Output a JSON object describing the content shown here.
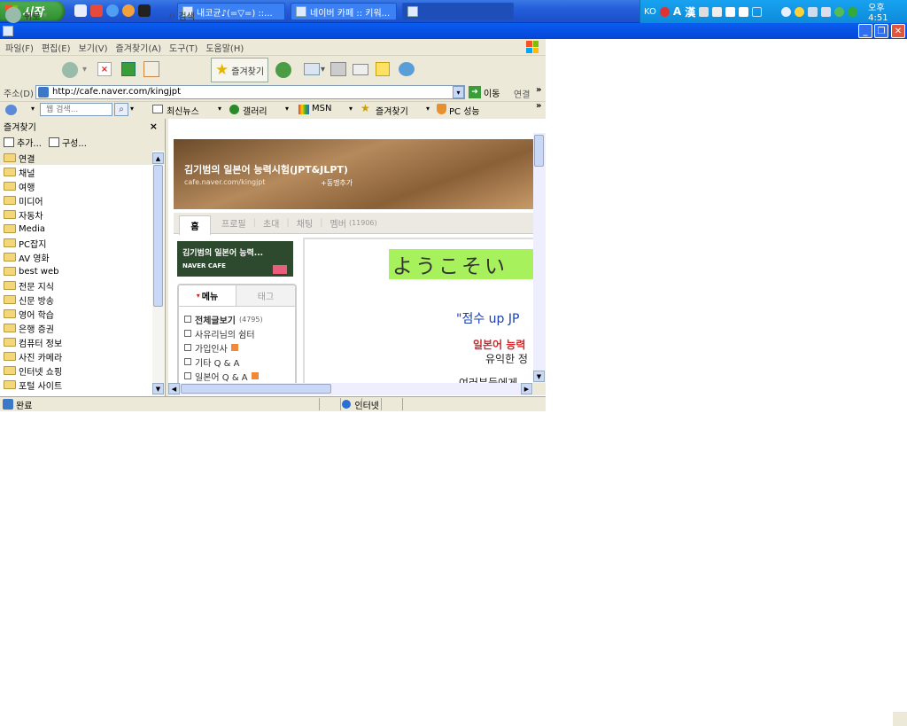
{
  "taskbar": {
    "start_label": "시작",
    "tasks": [
      {
        "label": "내코균♪(=▽=) ::..."
      },
      {
        "label": "네이버 카페 :: 키워..."
      },
      {
        "label": ""
      }
    ],
    "tray": {
      "ime": "KO",
      "ime_a": "A",
      "ime_han": "漢",
      "clock": "오후 4:51"
    }
  },
  "menu": {
    "items": [
      "파일(F)",
      "편집(E)",
      "보기(V)",
      "즐겨찾기(A)",
      "도구(T)",
      "도움말(H)"
    ]
  },
  "toolbar": {
    "back": "뒤로",
    "search": "검색",
    "favorites": "즐겨찾기"
  },
  "address": {
    "label": "주소(D)",
    "url": "http://cafe.naver.com/kingjpt",
    "go": "이동",
    "links": "연결"
  },
  "linksbar": {
    "search_placeholder": "웹 검색...",
    "news": "최신뉴스",
    "gallery": "갤러리",
    "msn": "MSN",
    "favorites": "즐겨찾기",
    "pc": "PC 성능"
  },
  "favorites": {
    "title": "즐겨찾기",
    "close": "×",
    "add": "추가...",
    "organize": "구성...",
    "items": [
      "연결",
      "채널",
      "여행",
      "미디어",
      "자동차",
      "Media",
      "PC잡지",
      "AV 영화",
      "best web",
      "전문 지식",
      "신문 방송",
      "영어 학습",
      "은행 증권",
      "컴퓨터 정보",
      "사진 카메라",
      "인터넷 쇼핑",
      "포털 사이트"
    ]
  },
  "cafe": {
    "title": "김기범의 일본어 능력시험(JPT&JLPT)",
    "url": "cafe.naver.com/kingjpt",
    "add_member": "+동맹추가",
    "tabs": {
      "home": "홈",
      "profile": "프로필",
      "invite": "초대",
      "chat": "채팅",
      "member": "멤버",
      "member_count": "(11906)"
    },
    "cafe_box_title": "김기범의 일본어 능력...",
    "cafe_box_sub": "NAVER CAFE",
    "menu_tab": "메뉴",
    "tag_tab": "태그",
    "menu_items": [
      {
        "label": "전체글보기",
        "count": "(4795)"
      },
      {
        "label": "사유리님의 쉼터",
        "count": ""
      },
      {
        "label": "가입인사",
        "count": ""
      },
      {
        "label": "기타 Q & A",
        "count": ""
      },
      {
        "label": "일본어 Q & A",
        "count": ""
      }
    ],
    "welcome": "ようこそい",
    "score_text": "\"점수 up JP",
    "red_text": "일본어 능력",
    "gray_text": "유익한 정",
    "bottom_text": "여러분들에게"
  },
  "status": {
    "done": "완료",
    "zone": "인터넷"
  },
  "colors": {
    "taskbar": "#245edb",
    "start": "#3c9a3c",
    "tray": "#0f93e0",
    "welcome_bg": "#a6f15c",
    "red": "#d8262a",
    "blue": "#1a3fb0"
  }
}
